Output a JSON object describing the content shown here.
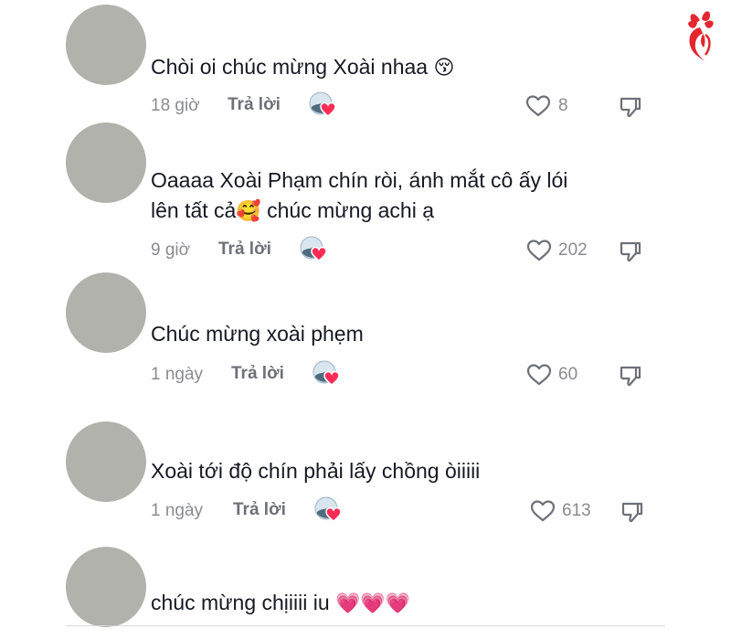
{
  "brand": {
    "logo_icon": "flower-face-logo-icon",
    "accent_color": "#e3262f"
  },
  "comments": [
    {
      "text": "Chòi oi chúc mừng Xoài nhaa",
      "emoji": "😚",
      "time": "18 giờ",
      "reply_label": "Trả lời",
      "likes": "8"
    },
    {
      "text_line1": "Oaaaa Xoài Phạm chín ròi, ánh mắt cô ấy lói",
      "text_line2_a": "lên tất cả",
      "emoji": "🥰",
      "text_line2_b": " chúc mừng achi ạ",
      "time": "9 giờ",
      "reply_label": "Trả lời",
      "likes": "202"
    },
    {
      "text": "Chúc mừng xoài phẹm",
      "time": "1 ngày",
      "reply_label": "Trả lời",
      "likes": "60"
    },
    {
      "text": "Xoài tới độ chín phải lấy chồng òiiiii",
      "time": "1 ngày",
      "reply_label": "Trả lời",
      "likes": "613"
    },
    {
      "text": "chúc mừng chịiiii iu ",
      "emoji": "💗💗💗"
    }
  ],
  "icons": {
    "like": "heart-outline-icon",
    "dislike": "thumbs-down-icon",
    "creator_liked": "creator-liked-badge-icon"
  }
}
